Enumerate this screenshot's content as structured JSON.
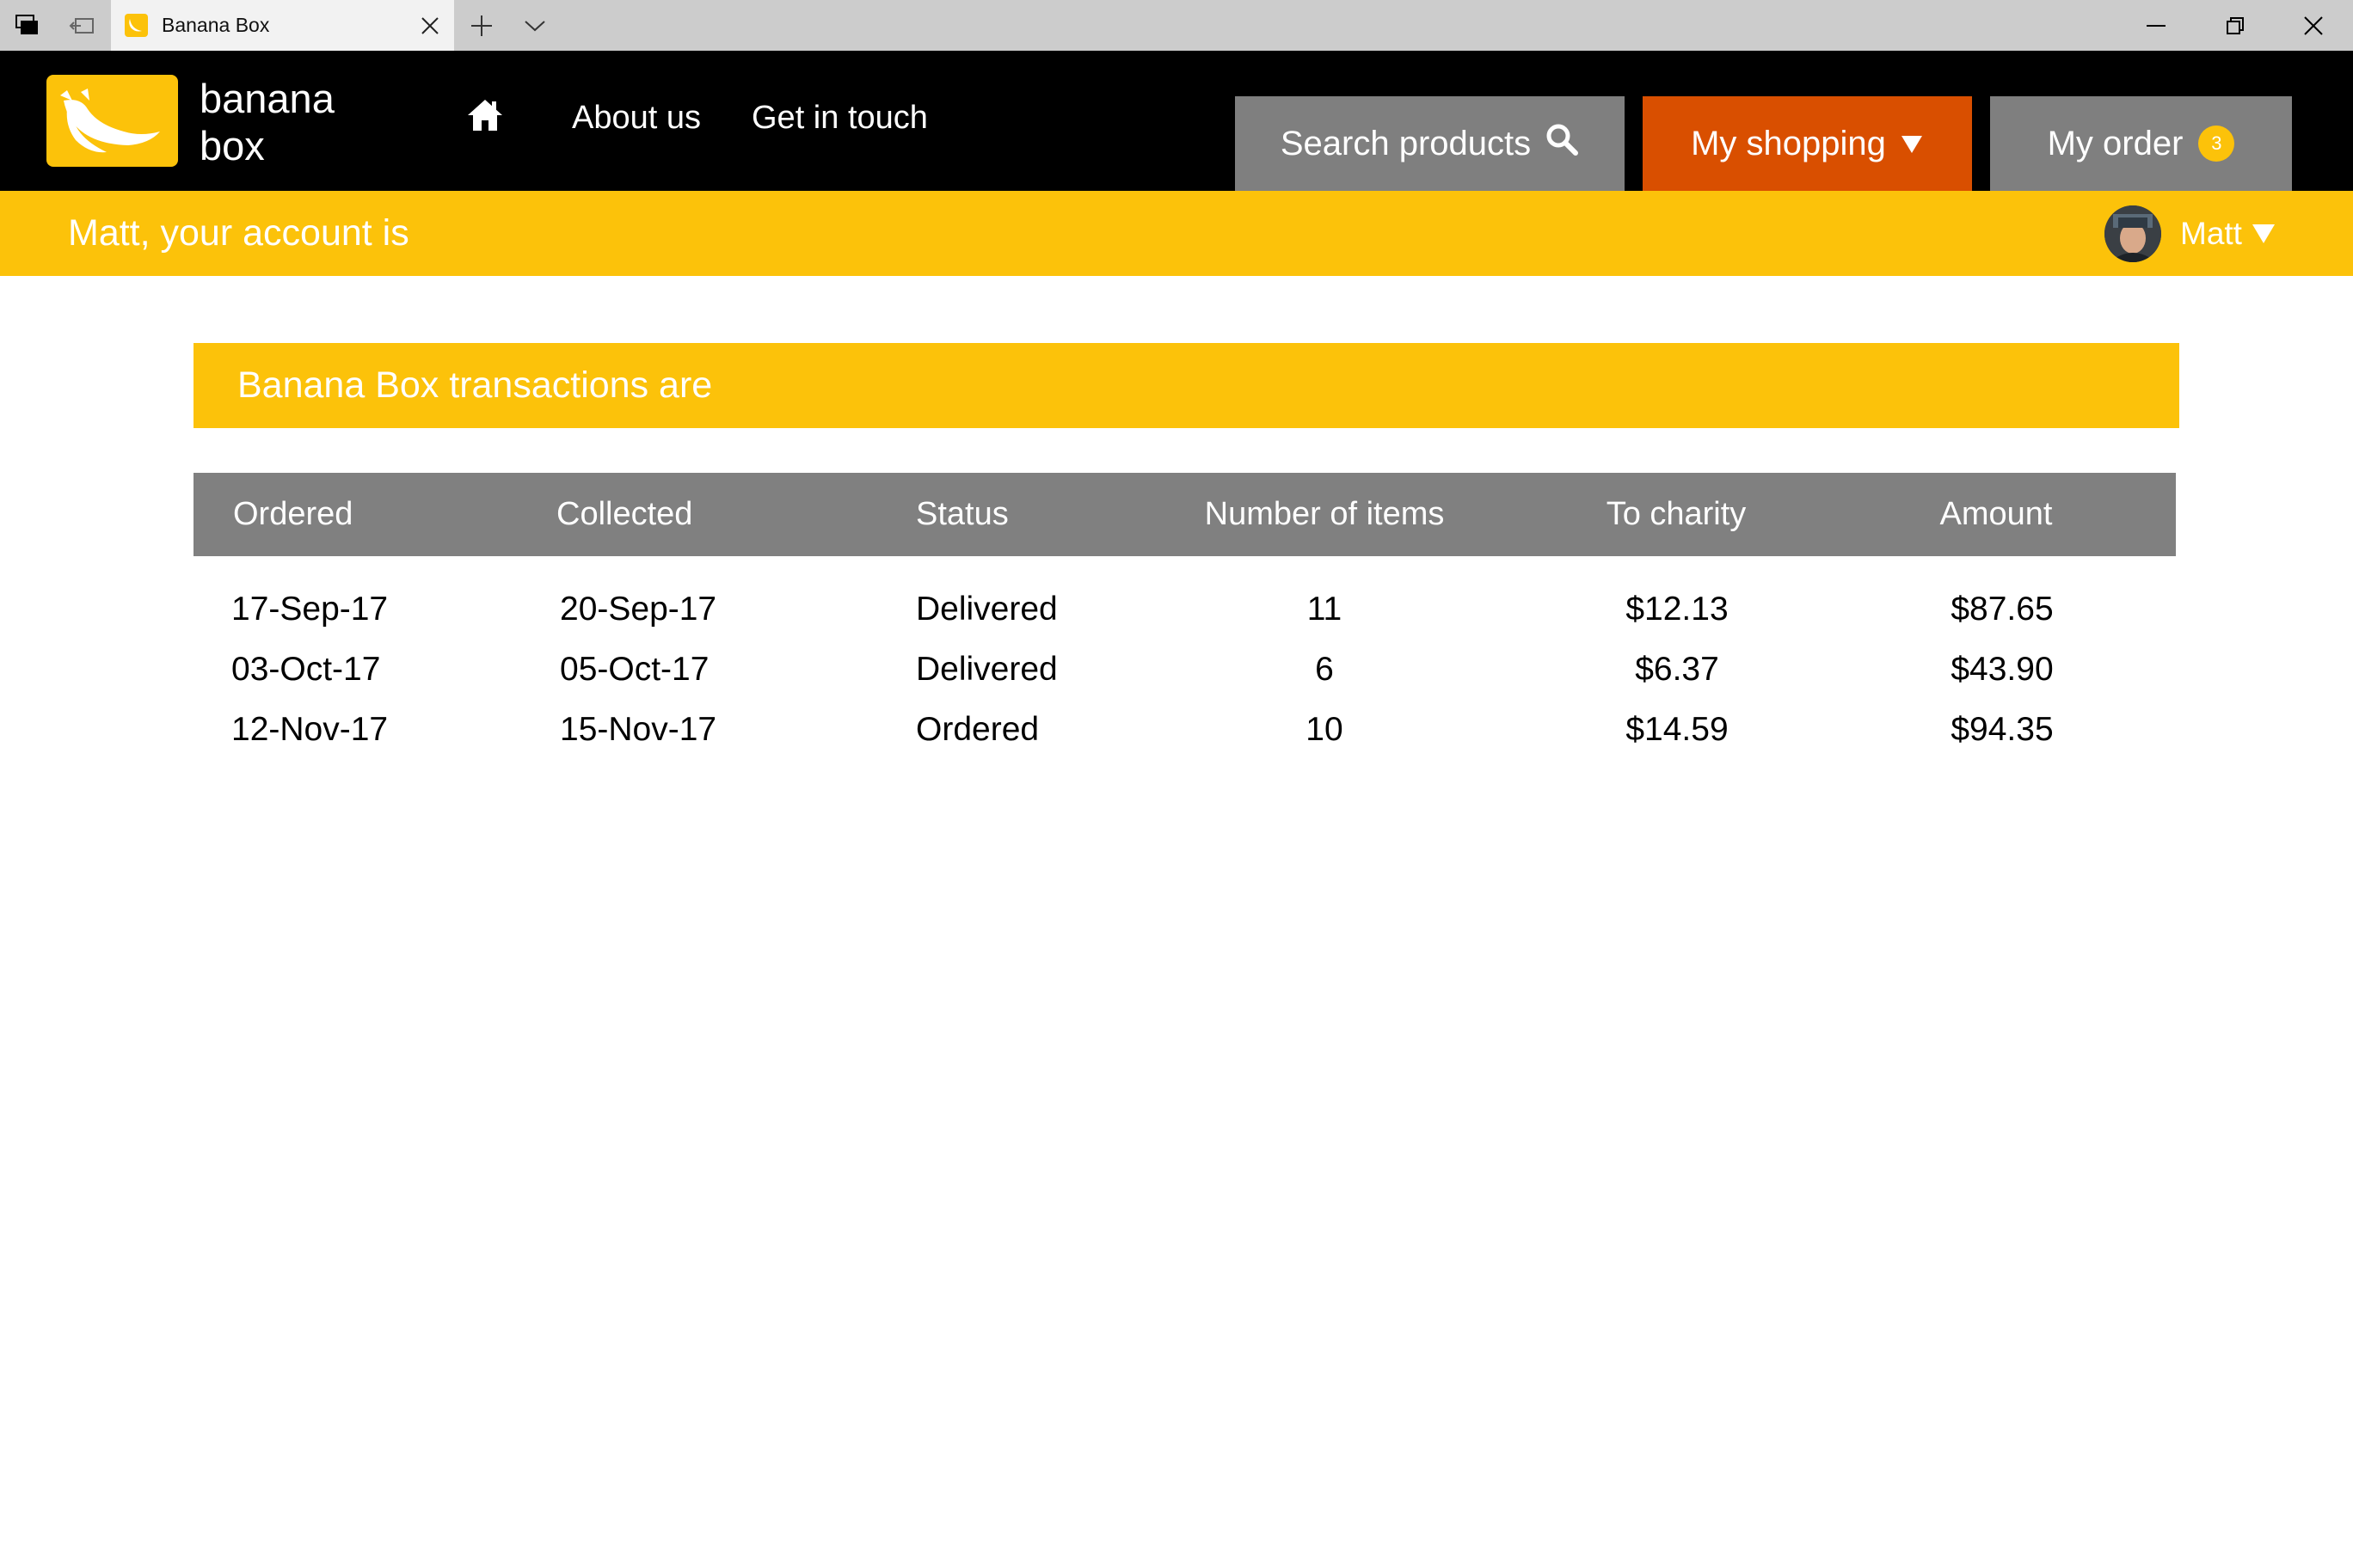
{
  "browser": {
    "tab_title": "Banana Box"
  },
  "header": {
    "logo_line1": "banana",
    "logo_line2": "box",
    "nav": {
      "about": "About us",
      "contact": "Get in touch"
    },
    "search_label": "Search products",
    "shopping_label": "My shopping",
    "order_label": "My order",
    "order_count": "3"
  },
  "account_bar": {
    "text": "Matt, your account is",
    "user_name": "Matt"
  },
  "transactions": {
    "title": "Banana Box transactions are",
    "columns": [
      "Ordered",
      "Collected",
      "Status",
      "Number of items",
      "To charity",
      "Amount"
    ],
    "rows": [
      [
        "17-Sep-17",
        "20-Sep-17",
        "Delivered",
        "11",
        "$12.13",
        "$87.65"
      ],
      [
        "03-Oct-17",
        "05-Oct-17",
        "Delivered",
        "6",
        "$6.37",
        "$43.90"
      ],
      [
        "12-Nov-17",
        "15-Nov-17",
        "Ordered",
        "10",
        "$14.59",
        "$94.35"
      ]
    ]
  },
  "colors": {
    "brand_yellow": "#fcc20a",
    "shopping_orange": "#d94f00",
    "header_black": "#000000",
    "button_grey": "#7f7f7f"
  }
}
